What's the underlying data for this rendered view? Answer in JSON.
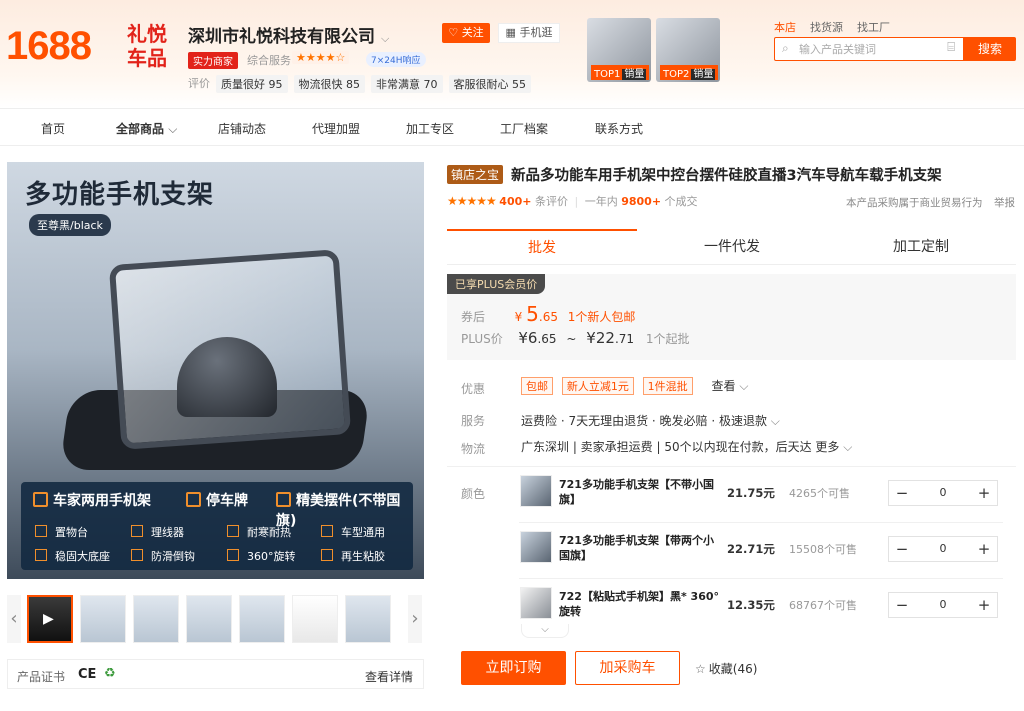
{
  "header": {
    "site_logo": "1688",
    "shop_logo_line1": "礼悦",
    "shop_logo_line2": "车品",
    "shop_name": "深圳市礼悦科技有限公司",
    "strength_badge": "实力商家",
    "composite_label": "综合服务",
    "response_badge": "7×24H响应",
    "eval_label": "评价",
    "evals": [
      "质量很好 95",
      "物流很快 85",
      "非常满意 70",
      "客服很耐心 55"
    ],
    "follow_label": "关注",
    "mobile_label": "手机逛",
    "top_thumbs": [
      {
        "rank": "TOP1",
        "tag": "销量"
      },
      {
        "rank": "TOP2",
        "tag": "销量"
      }
    ],
    "search_tabs": [
      "本店",
      "找货源",
      "找工厂"
    ],
    "search_placeholder": "输入产品关键词",
    "search_button": "搜索"
  },
  "nav": {
    "items": [
      "首页",
      "全部商品",
      "店铺动态",
      "代理加盟",
      "加工专区",
      "工厂档案",
      "联系方式"
    ]
  },
  "gallery": {
    "main_title": "多功能手机支架",
    "main_sub": "至尊黑/black",
    "features_big": [
      "车家两用手机架",
      "停车牌",
      "精美摆件(不带国旗)"
    ],
    "features_small": [
      "置物台",
      "理线器",
      "耐寒耐热",
      "车型通用",
      "稳固大底座",
      "防滑倒钩",
      "360°旋转",
      "再生粘胶"
    ],
    "cert_label": "产品证书",
    "cert_marks": [
      "CE",
      "♻"
    ],
    "cert_more": "查看详情"
  },
  "product": {
    "shop_tag": "镇店之宝",
    "title": "新品多功能车用手机架中控台摆件硅胶直播3汽车导航车载手机支架",
    "stars": "★★★★★",
    "review_count": "400+",
    "review_label": "条评价",
    "year_label": "一年内",
    "sold_count": "9800+",
    "sold_label": "个成交",
    "right_note": "本产品采购属于商业贸易行为",
    "report": "举报",
    "tabs": [
      "批发",
      "一件代发",
      "加工定制"
    ],
    "plus_badge": "已享PLUS会员价",
    "coupon_label": "券后",
    "coupon_currency": "¥",
    "coupon_int": "5",
    "coupon_dec": ".65",
    "coupon_note": "1个新人包邮",
    "plus_label": "PLUS价",
    "plus_low_int": "¥6",
    "plus_low_dec": ".65",
    "plus_tilde": "~",
    "plus_high_int": "¥22",
    "plus_high_dec": ".71",
    "plus_min": "1个起批",
    "discount_label": "优惠",
    "discount_pills": [
      "包邮",
      "新人立减1元",
      "1件混批"
    ],
    "discount_more": "查看",
    "service_label": "服务",
    "service_text": "运费险 · 7天无理由退货 · 晚发必赔 · 极速退款",
    "logistics_label": "物流",
    "logistics_text": "广东深圳 | 卖家承担运费 | 50个以内现在付款，后天达 更多",
    "color_label": "颜色",
    "variants": [
      {
        "name": "721多功能手机支架【不带小国旗】",
        "price": "21.75元",
        "stock": "4265个可售",
        "qty": "0"
      },
      {
        "name": "721多功能手机支架【带两个小国旗】",
        "price": "22.71元",
        "stock": "15508个可售",
        "qty": "0"
      },
      {
        "name": "722【粘贴式手机架】黑* 360°旋转",
        "price": "12.35元",
        "stock": "68767个可售",
        "qty": "0"
      }
    ],
    "buy_label": "立即订购",
    "cart_label": "加采购车",
    "fav_label": "收藏(46)"
  },
  "colors": {
    "accent": "#ff5000",
    "shop_red": "#e2231a",
    "tag_brown": "#ad5b17"
  }
}
